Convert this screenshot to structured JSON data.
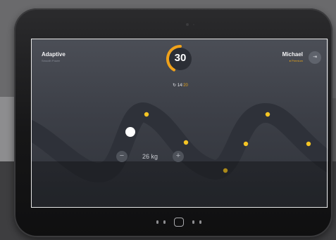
{
  "header": {
    "mode": "Adaptive",
    "mode_subtitle": "Smooth Power",
    "user_name": "Michael",
    "user_status": "● Premium",
    "avatar_icon": "exit-icon"
  },
  "timer": {
    "value": "30",
    "accent_color": "#f0a21a"
  },
  "reps": {
    "icon": "repeat-icon",
    "done": "14",
    "separator": "/",
    "total": "20"
  },
  "weight": {
    "value": "26 kg",
    "minus_icon": "minus-icon",
    "plus_icon": "plus-icon"
  },
  "colors": {
    "track": "#2e3139",
    "marker": "#f5c524",
    "cursor": "#ffffff"
  }
}
